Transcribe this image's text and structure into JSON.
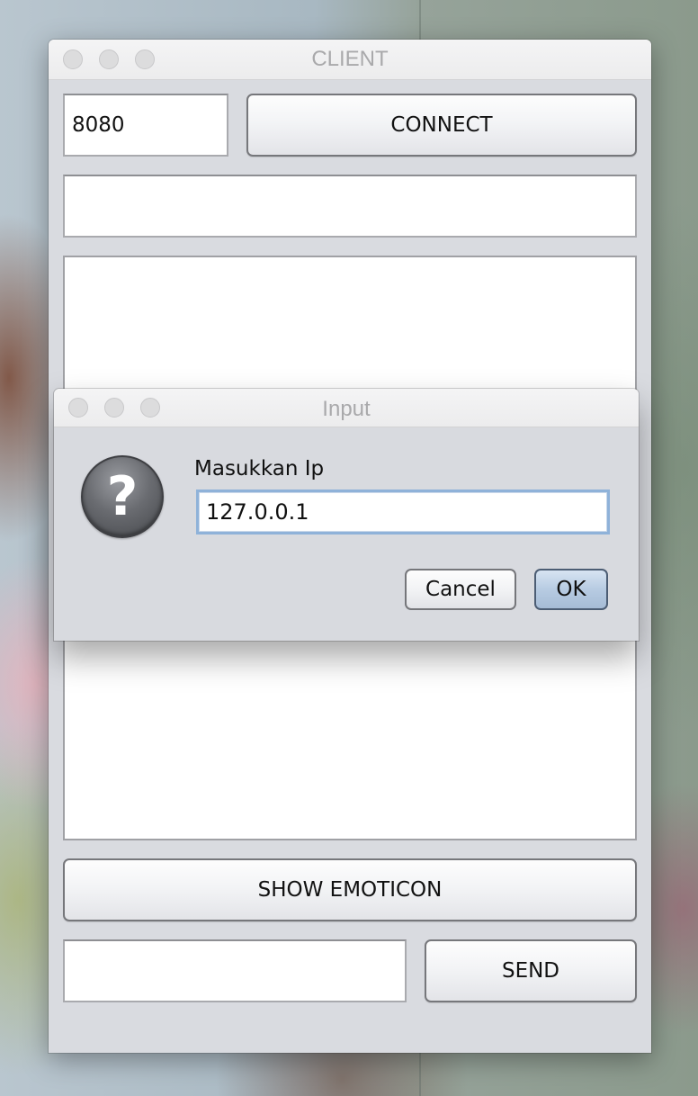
{
  "window": {
    "title": "CLIENT",
    "port_value": "8080",
    "connect_label": "CONNECT",
    "host_value": "",
    "chat_log": "",
    "show_emoticon_label": "SHOW EMOTICON",
    "message_value": "",
    "send_label": "SEND"
  },
  "dialog": {
    "title": "Input",
    "icon": "question-icon",
    "prompt": "Masukkan Ip",
    "ip_value": "127.0.0.1",
    "cancel_label": "Cancel",
    "ok_label": "OK"
  }
}
